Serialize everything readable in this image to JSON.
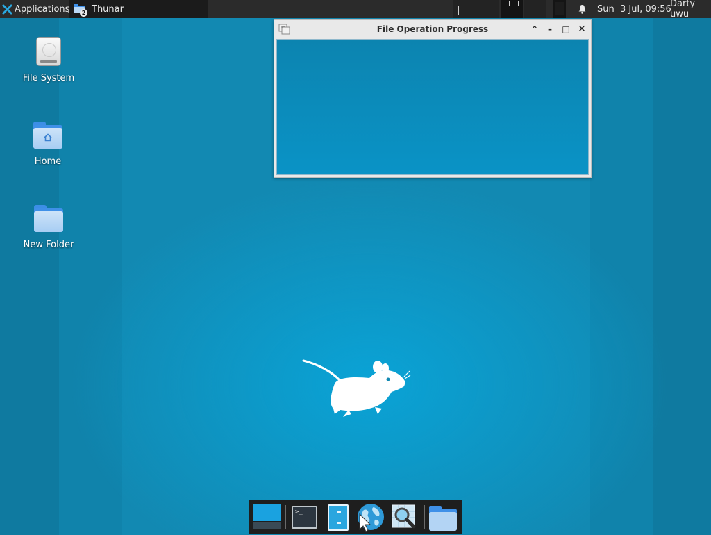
{
  "top_panel": {
    "applications_label": "Applications",
    "separator_glyph": "⋮",
    "task_title": "Thunar",
    "task_badge": "2",
    "clock": "Sun  3 Jul, 09:56",
    "user": "Darty uwu"
  },
  "desktop_icons": {
    "file_system": "File System",
    "home": "Home",
    "new_folder": "New Folder"
  },
  "dialog": {
    "title": "File Operation Progress",
    "shade_glyph": "⌃",
    "minimize_glyph": "–",
    "maximize_glyph": "□",
    "close_glyph": "✕"
  },
  "dock": {
    "terminal_prompt": ">_"
  },
  "colors": {
    "panel": "#2b2b2b",
    "desktop_blue": "#1289b2",
    "dialog_body": "#0a93c6"
  }
}
